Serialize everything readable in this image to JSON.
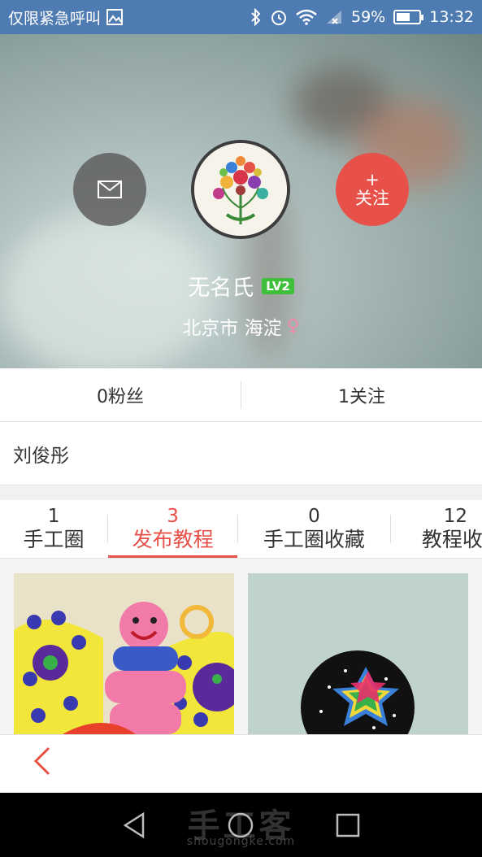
{
  "status_bar": {
    "carrier": "仅限紧急呼叫",
    "battery": "59%",
    "battery_level": 0.59,
    "time": "13:32"
  },
  "profile": {
    "name": "无名氏",
    "level": "LV2",
    "location": "北京市 海淀",
    "gender_symbol": "♀",
    "follow_plus": "+",
    "follow_label": "关注"
  },
  "stats": {
    "fans": "0粉丝",
    "following": "1关注"
  },
  "bio": "刘俊彤",
  "tabs": [
    {
      "count": "1",
      "label": "手工圈"
    },
    {
      "count": "3",
      "label": "发布教程",
      "active": true
    },
    {
      "count": "0",
      "label": "手工圈收藏"
    },
    {
      "count": "12",
      "label": "教程收"
    }
  ],
  "watermark": {
    "title": "手工客",
    "url": "shougongke.com"
  },
  "colors": {
    "accent": "#e8504a",
    "status_bar": "#4f7bb3",
    "level_badge": "#3fbf3a"
  }
}
